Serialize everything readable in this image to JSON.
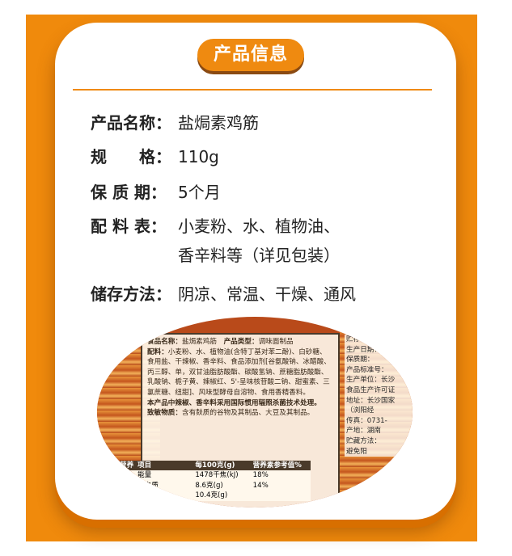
{
  "header": {
    "title": "产品信息"
  },
  "info": [
    {
      "label": "产品名称：",
      "value": "盐焗素鸡筋",
      "value2": ""
    },
    {
      "label": "规　　格：",
      "value": "110g",
      "value2": ""
    },
    {
      "label": "保 质 期：",
      "value": "5个月",
      "value2": ""
    },
    {
      "label": "配 料 表：",
      "value": "小麦粉、水、植物油、",
      "value2": "香辛料等（详见包装）"
    },
    {
      "label": "储存方法：",
      "value": "阴凉、常温、干燥、通风",
      "value2": ""
    }
  ],
  "package_label": {
    "name_key": "食品名称：",
    "name_val": "盐焗素鸡筋",
    "type_key": "产品类型：",
    "type_val": "调味面制品",
    "ingredients_key": "配料：",
    "ingredients": "小麦粉、水、植物油(含特丁基对苯二酚)、白砂糖、食用盐、干辣椒、香辛料、食品添加剂[谷氨酸钠、冰醋酸、丙三醇、单，双甘油脂肪酸酯、碳酸氢钠、蔗糖脂肪酸酯、乳酸钠、栀子黄、辣椒红、5'-呈味核苷酸二钠、甜蜜素、三氯蔗糖、纽甜]、风味型酵母自溶物、食用香精香料。",
    "irradiation": "本产品中辣椒、香辛料采用国际惯用辐照杀菌技术处理。",
    "allergen_key": "致敏物质：",
    "allergen": "含有麸质的谷物及其制品、大豆及其制品。",
    "nutrition": {
      "tab": "营养",
      "headers": [
        "项目",
        "每100克(g)",
        "营养素参考值%"
      ],
      "rows": [
        [
          "能量",
          "1478千焦(kJ)",
          "18%"
        ],
        [
          "蛋白质",
          "8.6克(g)",
          "14%"
        ],
        [
          "",
          "10.4克(g)",
          ""
        ]
      ]
    },
    "side": [
      "贮存条件：",
      "生产日期：",
      "保质期：",
      "产品标准号：",
      "生产单位：长沙",
      "食品生产许可证",
      "地址：长沙国家",
      "（浏阳经",
      "传真：0731-",
      "产地：湖南",
      "贮藏方法：",
      "避免阳"
    ]
  }
}
